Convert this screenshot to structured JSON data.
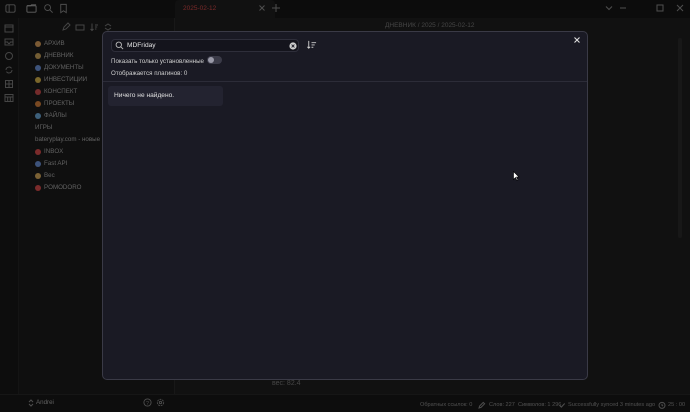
{
  "tab": {
    "title": "2025-02-12"
  },
  "breadcrumb": {
    "path": "ДНЕВНИК / 2025 / 2025-02-12"
  },
  "sidebar": {
    "items": [
      {
        "label": "АРХИВ",
        "color": "#d49c5a"
      },
      {
        "label": "ДНЕВНИК",
        "color": "#c9a25b"
      },
      {
        "label": "ДОКУМЕНТЫ",
        "color": "#6a8fd4"
      },
      {
        "label": "ИНВЕСТИЦИИ",
        "color": "#d4b14a"
      },
      {
        "label": "КОНСПЕКТ",
        "color": "#c94a4a"
      },
      {
        "label": "ПРОЕКТЫ",
        "color": "#d07e3c"
      },
      {
        "label": "ФАЙЛЫ",
        "color": "#6aa6d4"
      },
      {
        "label": "ИГРЫ",
        "color": ""
      },
      {
        "label": "bateryplay.com - новые",
        "color": ""
      },
      {
        "label": "INBOX",
        "color": "#d44a4a"
      },
      {
        "label": "Fast API",
        "color": "#6a8fd4"
      },
      {
        "label": "Вес",
        "color": "#d4a85a"
      },
      {
        "label": "POMODORO",
        "color": "#d44a4a"
      }
    ]
  },
  "editor": {
    "visible_text": "вес: 82.4"
  },
  "status": {
    "user": "Andrei",
    "backlinks": "Обратных ссылок: 0",
    "words": "Слов: 227",
    "chars": "Символов: 1 296",
    "sync": "Successfully synced 3 minutes ago",
    "time": "25 : 00"
  },
  "modal": {
    "search_value": "MDFriday",
    "toggle_label": "Показать только установленные",
    "count_label": "Отображается плагинов: 0",
    "empty_text": "Ничего не найдено."
  },
  "colors": {
    "accent": "#d04747",
    "modal_bg": "#1a1a24"
  }
}
